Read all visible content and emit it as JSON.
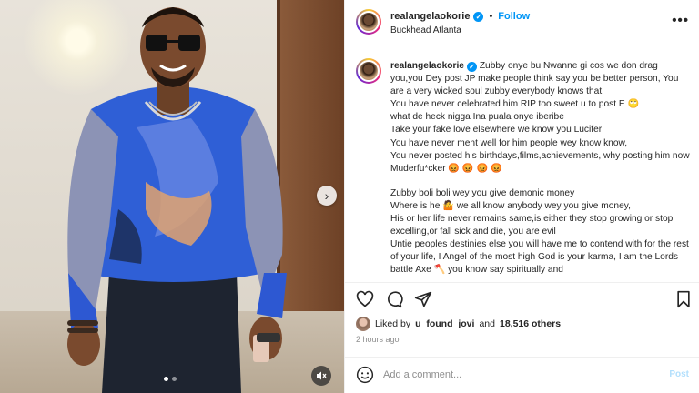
{
  "post": {
    "username": "realangelaokorie",
    "follow_label": "Follow",
    "location": "Buckhead Atlanta",
    "more_label": "•••",
    "caption_lines": [
      "Zubby onye bu Nwanne gi cos we don drag you,you Dey post JP make people think say you be better person, You are a very wicked soul zubby everybody knows that",
      "You have never celebrated him RIP too sweet u to post E 🙄",
      "what de heck nigga Ina puala onye iberibe",
      "Take your fake love elsewhere we know you Lucifer",
      "You have never ment well for him people wey know know,",
      "You never posted his birthdays,films,achievements, why posting him now Muderfu*cker 😡 😡 😡 😡"
    ],
    "caption_lines_2": [
      "Zubby boli boli wey you give demonic money",
      "Where is he 🤷 we all know anybody wey you give money,",
      "His or her life never remains same,is either they stop growing or stop excelling,or fall sick and die, you are evil",
      "Untie peoples destinies else you will have me to contend with for the rest of your life, I Angel of the most high God is your karma, I am the Lords battle Axe 🪓 you know say spiritually and"
    ],
    "liked_by_prefix": "Liked by",
    "liked_by_user": "u_found_jovi",
    "liked_by_and": "and",
    "likes_count": "18,516 others",
    "timestamp": "2 hours ago",
    "comment_placeholder": "Add a comment...",
    "post_label": "Post"
  },
  "media": {
    "next_label": "›",
    "carousel_dots": 2,
    "active_dot": 0
  },
  "colors": {
    "accent": "#0095f6",
    "text": "#262626",
    "muted": "#8e8e8e"
  }
}
